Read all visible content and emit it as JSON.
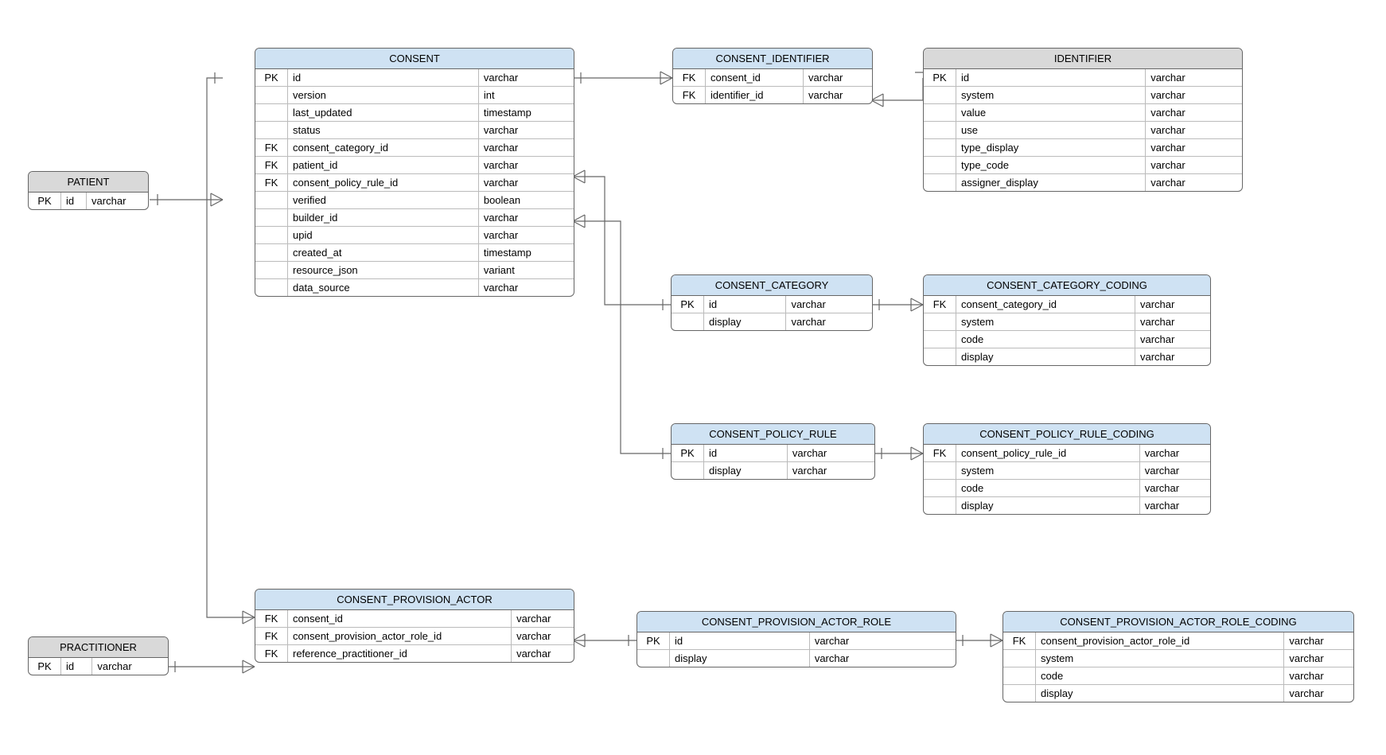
{
  "entities": {
    "patient": {
      "title": "PATIENT",
      "header_color": "grey",
      "columns": [
        {
          "key": "PK",
          "name": "id",
          "type": "varchar"
        }
      ]
    },
    "practitioner": {
      "title": "PRACTITIONER",
      "header_color": "grey",
      "columns": [
        {
          "key": "PK",
          "name": "id",
          "type": "varchar"
        }
      ]
    },
    "consent": {
      "title": "CONSENT",
      "header_color": "blue",
      "columns": [
        {
          "key": "PK",
          "name": "id",
          "type": "varchar"
        },
        {
          "key": "",
          "name": "version",
          "type": "int"
        },
        {
          "key": "",
          "name": "last_updated",
          "type": "timestamp"
        },
        {
          "key": "",
          "name": "status",
          "type": "varchar"
        },
        {
          "key": "FK",
          "name": "consent_category_id",
          "type": "varchar"
        },
        {
          "key": "FK",
          "name": "patient_id",
          "type": "varchar"
        },
        {
          "key": "FK",
          "name": "consent_policy_rule_id",
          "type": "varchar"
        },
        {
          "key": "",
          "name": "verified",
          "type": "boolean"
        },
        {
          "key": "",
          "name": "builder_id",
          "type": "varchar"
        },
        {
          "key": "",
          "name": "upid",
          "type": "varchar"
        },
        {
          "key": "",
          "name": "created_at",
          "type": "timestamp"
        },
        {
          "key": "",
          "name": "resource_json",
          "type": "variant"
        },
        {
          "key": "",
          "name": "data_source",
          "type": "varchar"
        }
      ]
    },
    "consent_identifier": {
      "title": "CONSENT_IDENTIFIER",
      "header_color": "blue",
      "columns": [
        {
          "key": "FK",
          "name": "consent_id",
          "type": "varchar"
        },
        {
          "key": "FK",
          "name": "identifier_id",
          "type": "varchar"
        }
      ]
    },
    "identifier": {
      "title": "IDENTIFIER",
      "header_color": "grey",
      "columns": [
        {
          "key": "PK",
          "name": "id",
          "type": "varchar"
        },
        {
          "key": "",
          "name": "system",
          "type": "varchar"
        },
        {
          "key": "",
          "name": "value",
          "type": "varchar"
        },
        {
          "key": "",
          "name": "use",
          "type": "varchar"
        },
        {
          "key": "",
          "name": "type_display",
          "type": "varchar"
        },
        {
          "key": "",
          "name": "type_code",
          "type": "varchar"
        },
        {
          "key": "",
          "name": "assigner_display",
          "type": "varchar"
        }
      ]
    },
    "consent_category": {
      "title": "CONSENT_CATEGORY",
      "header_color": "blue",
      "columns": [
        {
          "key": "PK",
          "name": "id",
          "type": "varchar"
        },
        {
          "key": "",
          "name": "display",
          "type": "varchar"
        }
      ]
    },
    "consent_category_coding": {
      "title": "CONSENT_CATEGORY_CODING",
      "header_color": "blue",
      "columns": [
        {
          "key": "FK",
          "name": "consent_category_id",
          "type": "varchar"
        },
        {
          "key": "",
          "name": "system",
          "type": "varchar"
        },
        {
          "key": "",
          "name": "code",
          "type": "varchar"
        },
        {
          "key": "",
          "name": "display",
          "type": "varchar"
        }
      ]
    },
    "consent_policy_rule": {
      "title": "CONSENT_POLICY_RULE",
      "header_color": "blue",
      "columns": [
        {
          "key": "PK",
          "name": "id",
          "type": "varchar"
        },
        {
          "key": "",
          "name": "display",
          "type": "varchar"
        }
      ]
    },
    "consent_policy_rule_coding": {
      "title": "CONSENT_POLICY_RULE_CODING",
      "header_color": "blue",
      "columns": [
        {
          "key": "FK",
          "name": "consent_policy_rule_id",
          "type": "varchar"
        },
        {
          "key": "",
          "name": "system",
          "type": "varchar"
        },
        {
          "key": "",
          "name": "code",
          "type": "varchar"
        },
        {
          "key": "",
          "name": "display",
          "type": "varchar"
        }
      ]
    },
    "consent_provision_actor": {
      "title": "CONSENT_PROVISION_ACTOR",
      "header_color": "blue",
      "columns": [
        {
          "key": "FK",
          "name": "consent_id",
          "type": "varchar"
        },
        {
          "key": "FK",
          "name": "consent_provision_actor_role_id",
          "type": "varchar"
        },
        {
          "key": "FK",
          "name": "reference_practitioner_id",
          "type": "varchar"
        }
      ]
    },
    "consent_provision_actor_role": {
      "title": "CONSENT_PROVISION_ACTOR_ROLE",
      "header_color": "blue",
      "columns": [
        {
          "key": "PK",
          "name": "id",
          "type": "varchar"
        },
        {
          "key": "",
          "name": "display",
          "type": "varchar"
        }
      ]
    },
    "consent_provision_actor_role_coding": {
      "title": "CONSENT_PROVISION_ACTOR_ROLE_CODING",
      "header_color": "blue",
      "columns": [
        {
          "key": "FK",
          "name": "consent_provision_actor_role_id",
          "type": "varchar"
        },
        {
          "key": "",
          "name": "system",
          "type": "varchar"
        },
        {
          "key": "",
          "name": "code",
          "type": "varchar"
        },
        {
          "key": "",
          "name": "display",
          "type": "varchar"
        }
      ]
    }
  },
  "relationships": [
    {
      "from": "patient.id",
      "to": "consent.patient_id",
      "type": "one-to-many"
    },
    {
      "from": "consent.id",
      "to": "consent_identifier.consent_id",
      "type": "one-to-many"
    },
    {
      "from": "identifier.id",
      "to": "consent_identifier.identifier_id",
      "type": "one-to-many"
    },
    {
      "from": "consent_category.id",
      "to": "consent.consent_category_id",
      "type": "one-to-many"
    },
    {
      "from": "consent_category.id",
      "to": "consent_category_coding.consent_category_id",
      "type": "one-to-many"
    },
    {
      "from": "consent_policy_rule.id",
      "to": "consent.consent_policy_rule_id",
      "type": "one-to-many"
    },
    {
      "from": "consent_policy_rule.id",
      "to": "consent_policy_rule_coding.consent_policy_rule_id",
      "type": "one-to-many"
    },
    {
      "from": "consent.id",
      "to": "consent_provision_actor.consent_id",
      "type": "one-to-many"
    },
    {
      "from": "practitioner.id",
      "to": "consent_provision_actor.reference_practitioner_id",
      "type": "one-to-many"
    },
    {
      "from": "consent_provision_actor_role.id",
      "to": "consent_provision_actor.consent_provision_actor_role_id",
      "type": "one-to-many"
    },
    {
      "from": "consent_provision_actor_role.id",
      "to": "consent_provision_actor_role_coding.consent_provision_actor_role_id",
      "type": "one-to-many"
    }
  ]
}
